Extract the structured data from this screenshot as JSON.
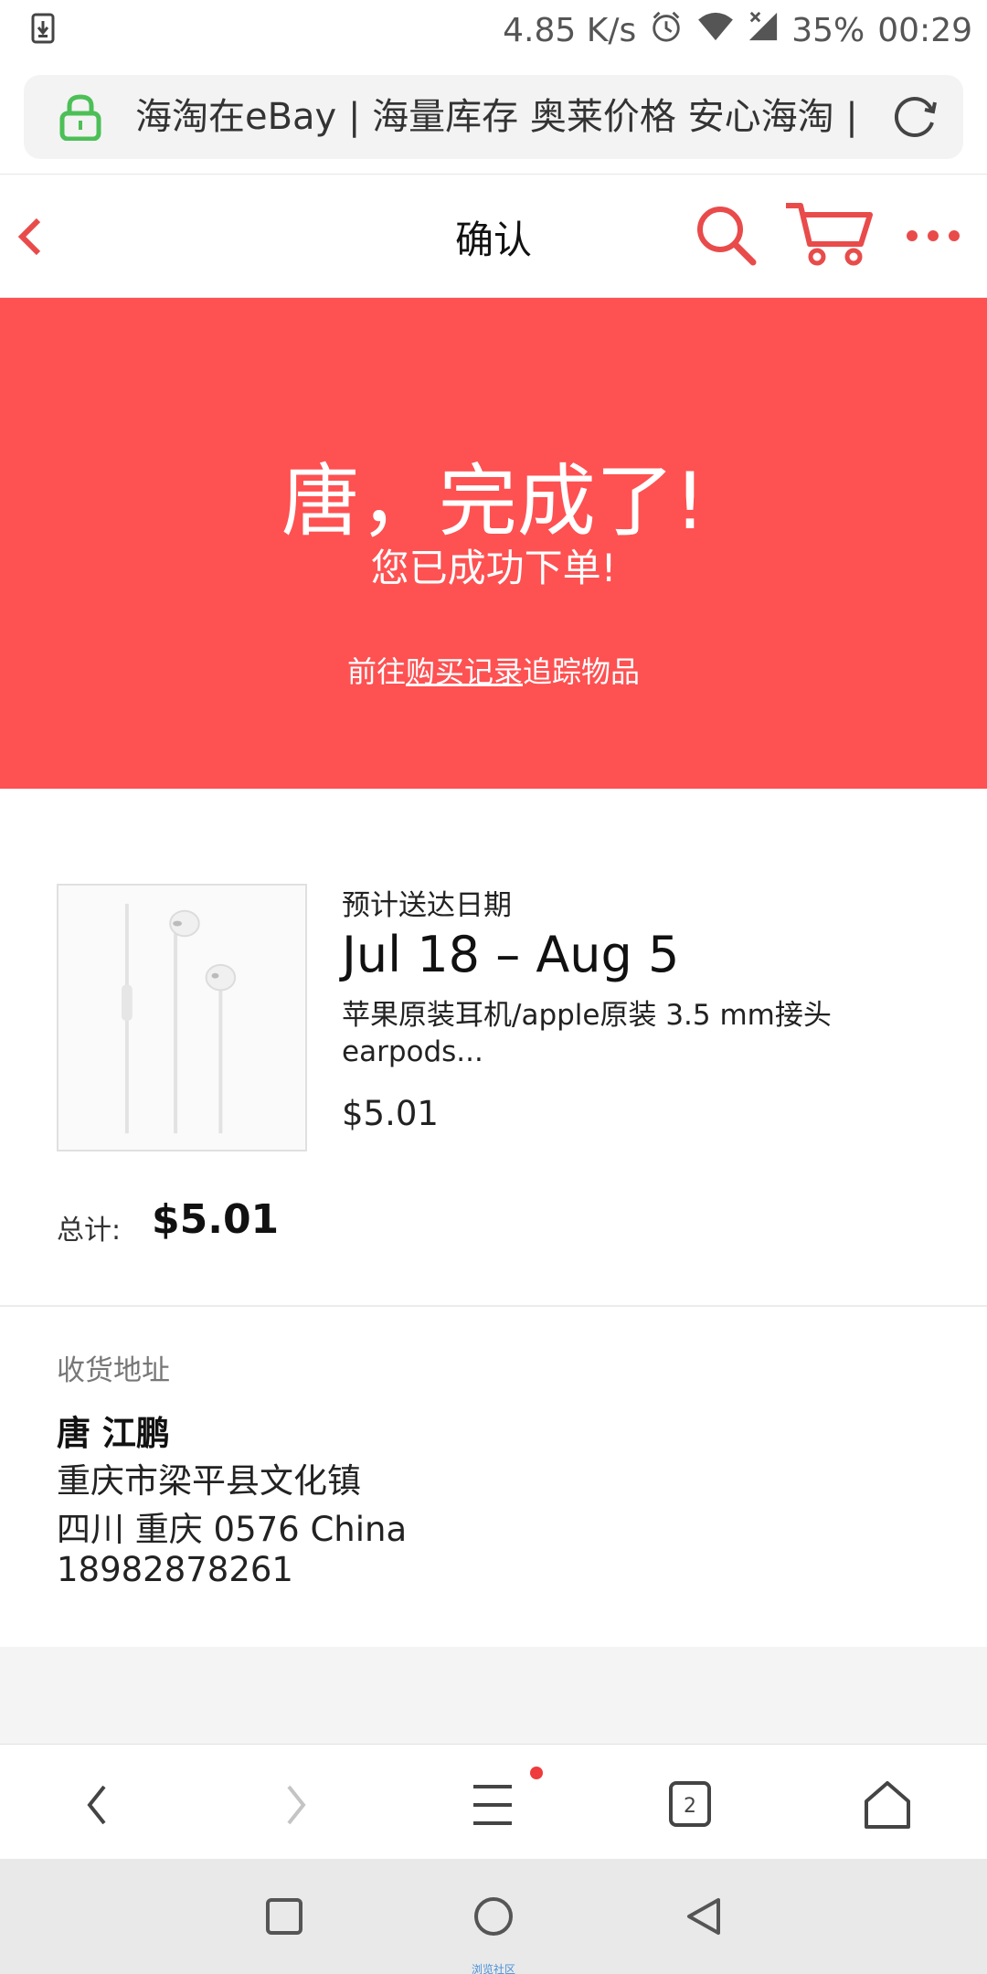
{
  "status_bar": {
    "net_speed": "4.85 K/s",
    "battery": "35%",
    "time": "00:29",
    "icons": [
      "download-icon",
      "alarm-icon",
      "wifi-icon",
      "signal-icon"
    ]
  },
  "url_bar": {
    "text": "海淘在eBay | 海量库存 奥莱价格 安心海淘 |",
    "icons": [
      "lock-icon",
      "reload-icon"
    ]
  },
  "nav": {
    "title": "确认",
    "icons": [
      "back-icon",
      "search-icon",
      "cart-icon",
      "more-icon"
    ]
  },
  "hero": {
    "title": "唐，完成了!",
    "subtitle": "您已成功下单!",
    "track_prefix": "前往",
    "track_link": "购买记录",
    "track_suffix": "追踪物品"
  },
  "order": {
    "eta_label": "预计送达日期",
    "eta_value": "Jul 18 – Aug 5",
    "product_name": "苹果原装耳机/apple原装 3.5 mm接头 earpods...",
    "product_price": "$5.01",
    "total_label": "总计:",
    "total_value": "$5.01"
  },
  "address": {
    "label": "收货地址",
    "name": "唐 江鹏",
    "line1": "重庆市梁平县文化镇",
    "line2": "四川 重庆 0576 China",
    "phone": "18982878261"
  },
  "browser_bar": {
    "tab_count": "2",
    "icons": [
      "back-arrow-icon",
      "forward-arrow-icon",
      "menu-icon",
      "tabs-icon",
      "home-icon"
    ]
  },
  "system_nav": {
    "caption": "浏览社区",
    "icons": [
      "recents-icon",
      "home-circle-icon",
      "back-triangle-icon"
    ]
  },
  "colors": {
    "accent": "#fe5152",
    "icon_red": "#e94b4b",
    "lock_green": "#4cbf57"
  }
}
